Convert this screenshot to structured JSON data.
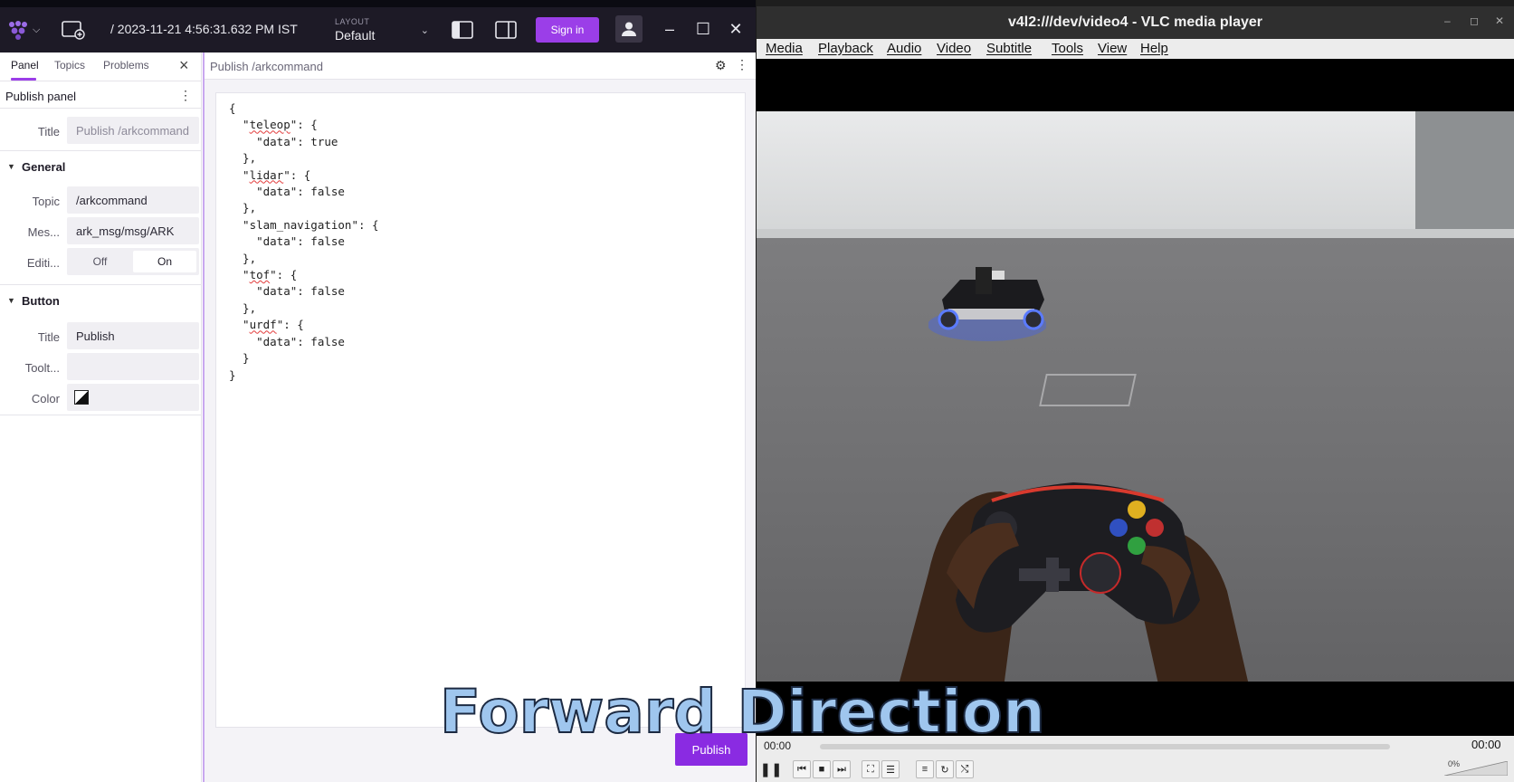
{
  "foxglove": {
    "timestamp": "/ 2023-11-21 4:56:31.632 PM IST",
    "layout": {
      "label": "LAYOUT",
      "value": "Default"
    },
    "sign_in": "Sign in",
    "sidebar": {
      "tabs": [
        "Panel",
        "Topics",
        "Problems"
      ],
      "panel_title": "Publish panel",
      "title_label": "Title",
      "title_placeholder": "Publish /arkcommand",
      "general": {
        "label": "General",
        "topic_label": "Topic",
        "topic_value": "/arkcommand",
        "message_label": "Mes...",
        "message_value": "ark_msg/msg/ARK",
        "editing_label": "Editi...",
        "off": "Off",
        "on": "On"
      },
      "button": {
        "label": "Button",
        "title_label": "Title",
        "title_value": "Publish",
        "tooltip_label": "Toolt...",
        "tooltip_value": "",
        "color_label": "Color"
      }
    },
    "publish_panel": {
      "title": "Publish /arkcommand",
      "publish_button": "Publish",
      "code_lines": [
        "{",
        "  \"teleop\": {",
        "    \"data\": true",
        "  },",
        "  \"lidar\": {",
        "    \"data\": false",
        "  },",
        "  \"slam_navigation\": {",
        "    \"data\": false",
        "  },",
        "  \"tof\": {",
        "    \"data\": false",
        "  },",
        "  \"urdf\": {",
        "    \"data\": false",
        "  }",
        "}"
      ]
    }
  },
  "vlc": {
    "title": "v4l2:///dev/video4 - VLC media player",
    "menu": [
      "Media",
      "Playback",
      "Audio",
      "Video",
      "Subtitle",
      "Tools",
      "View",
      "Help"
    ],
    "time_start": "00:00",
    "time_end": "00:00",
    "volume": "0%"
  },
  "caption": "Forward Direction",
  "colors": {
    "accent": "#9b3ee8",
    "publish": "#8a2be2",
    "caption": "#9fc6ee"
  }
}
